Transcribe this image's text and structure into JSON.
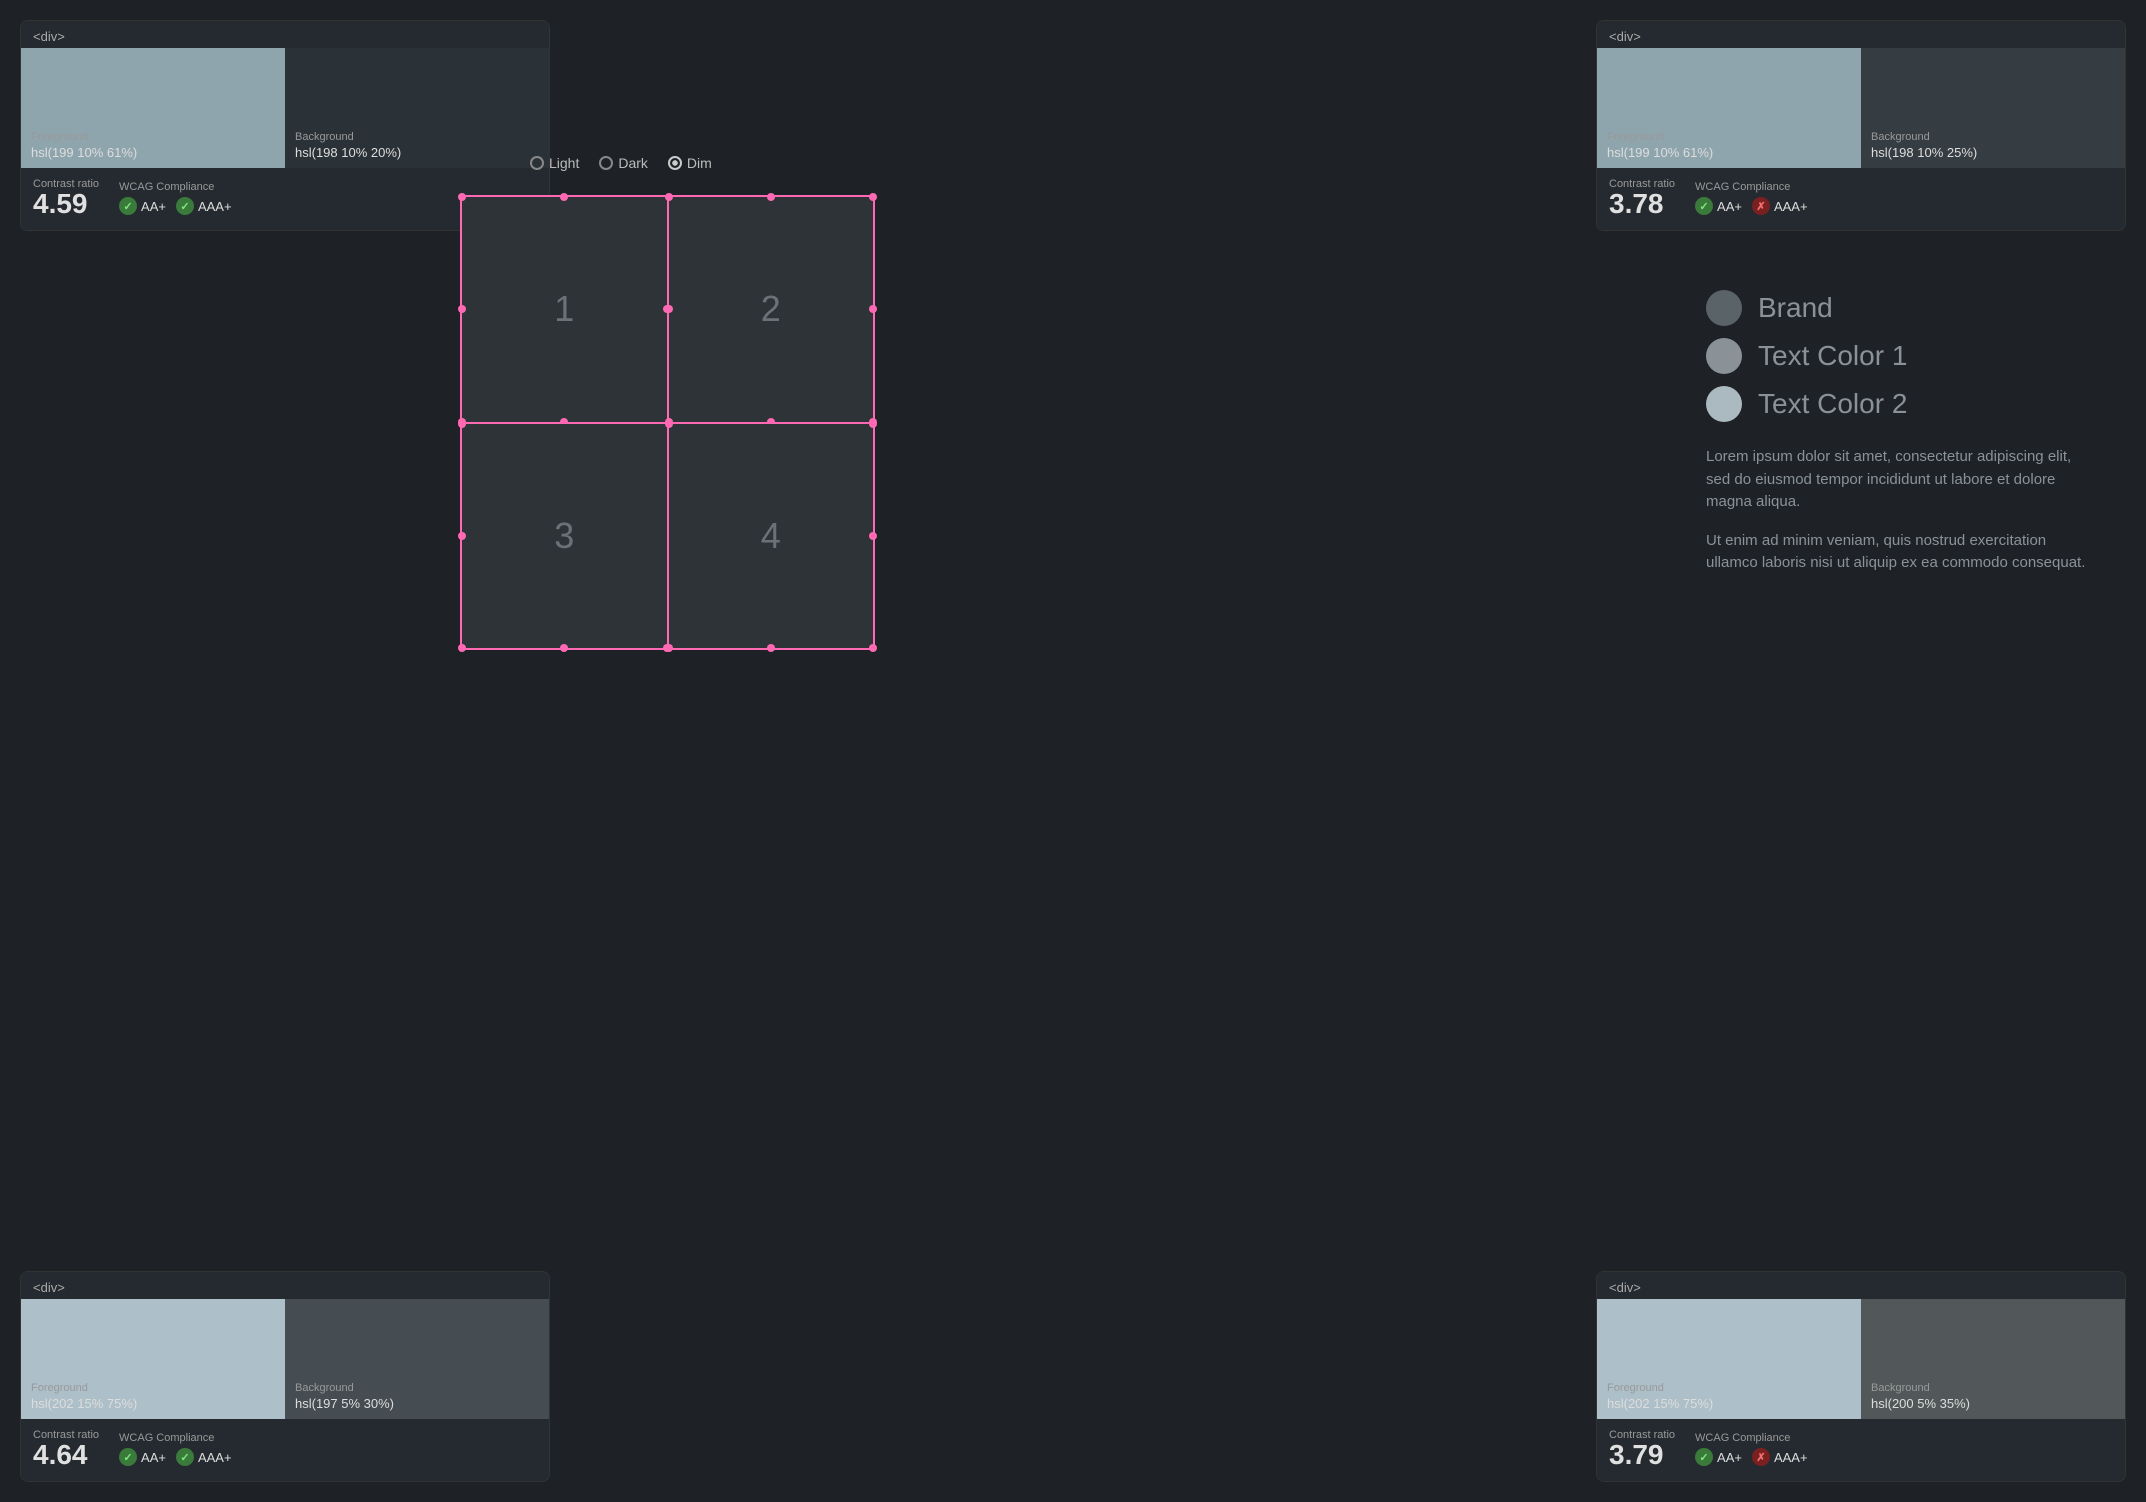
{
  "panels": {
    "top_left": {
      "tag": "<div>",
      "foreground_label": "Foreground",
      "foreground_value": "hsl(199 10% 61%)",
      "background_label": "Background",
      "background_value": "hsl(198 10% 20%)",
      "foreground_color": "#8fa5ae",
      "background_color": "#2b3237",
      "contrast_label": "Contrast ratio",
      "contrast_value": "4.59",
      "wcag_label": "WCAG Compliance",
      "aa_label": "AA+",
      "aaa_label": "AAA+",
      "aa_pass": true,
      "aaa_pass": true
    },
    "top_right": {
      "tag": "<div>",
      "foreground_label": "Foreground",
      "foreground_value": "hsl(199 10% 61%)",
      "background_label": "Background",
      "background_value": "hsl(198 10% 25%)",
      "foreground_color": "#8fa5ae",
      "background_color": "#353c42",
      "contrast_label": "Contrast ratio",
      "contrast_value": "3.78",
      "wcag_label": "WCAG Compliance",
      "aa_label": "AA+",
      "aaa_label": "AAA+",
      "aa_pass": true,
      "aaa_pass": false
    },
    "bottom_left": {
      "tag": "<div>",
      "foreground_label": "Foreground",
      "foreground_value": "hsl(202 15% 75%)",
      "background_label": "Background",
      "background_value": "hsl(197 5% 30%)",
      "foreground_color": "#adbfc8",
      "background_color": "#464d52",
      "contrast_label": "Contrast ratio",
      "contrast_value": "4.64",
      "wcag_label": "WCAG Compliance",
      "aa_label": "AA+",
      "aaa_label": "AAA+",
      "aa_pass": true,
      "aaa_pass": true
    },
    "bottom_right": {
      "tag": "<div>",
      "foreground_label": "Foreground",
      "foreground_value": "hsl(202 15% 75%)",
      "background_label": "Background",
      "background_value": "hsl(200 5% 35%)",
      "foreground_color": "#adbfc8",
      "background_color": "#525859",
      "contrast_label": "Contrast ratio",
      "contrast_value": "3.79",
      "wcag_label": "WCAG Compliance",
      "aa_label": "AA+",
      "aaa_label": "AAA+",
      "aa_pass": true,
      "aaa_pass": false
    }
  },
  "theme": {
    "options": [
      "Light",
      "Dark",
      "Dim"
    ],
    "selected": "Dim"
  },
  "grid": {
    "cells": [
      "1",
      "2",
      "3",
      "4"
    ]
  },
  "legend": {
    "items": [
      {
        "label": "Brand",
        "color": "#5a6368"
      },
      {
        "label": "Text Color 1",
        "color": "#8a9298"
      },
      {
        "label": "Text Color 2",
        "color": "#aabac0"
      }
    ]
  },
  "lorem": [
    "Lorem ipsum dolor sit amet, consectetur adipiscing elit, sed do eiusmod tempor incididunt ut labore et dolore magna aliqua.",
    "Ut enim ad minim veniam, quis nostrud exercitation ullamco laboris nisi ut aliquip ex ea commodo consequat."
  ]
}
